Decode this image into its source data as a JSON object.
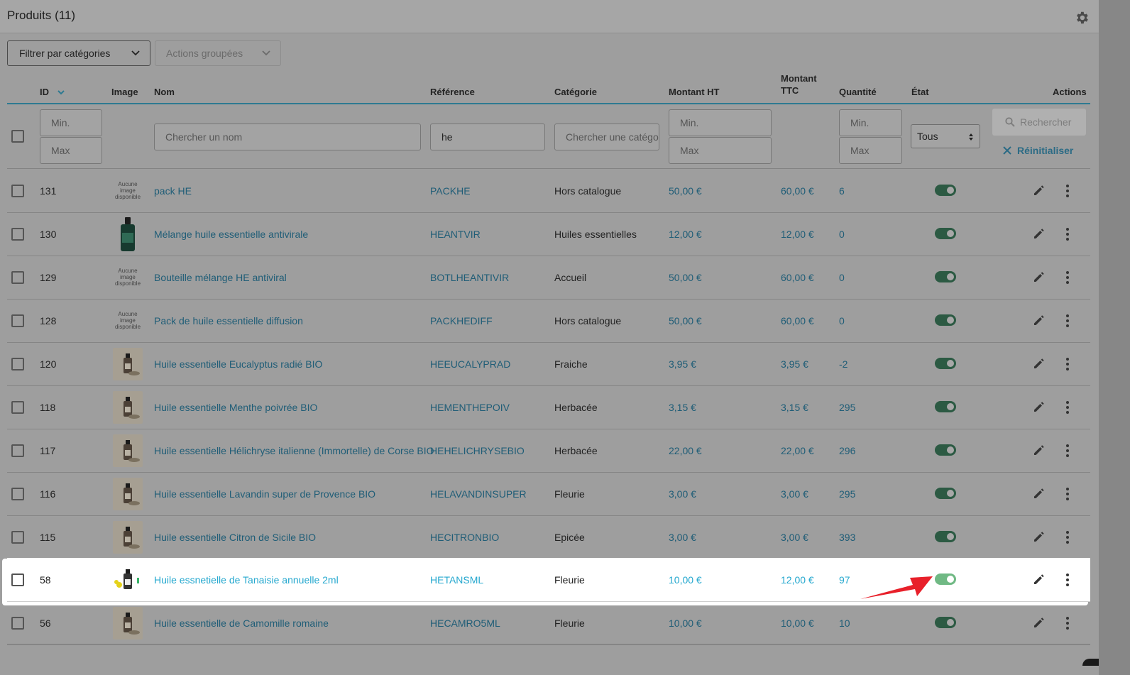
{
  "header": {
    "title": "Produits (11)"
  },
  "toolbar": {
    "filter_label": "Filtrer par catégories",
    "bulk_label": "Actions groupées"
  },
  "columns": {
    "id": "ID",
    "image": "Image",
    "name": "Nom",
    "reference": "Référence",
    "category": "Catégorie",
    "price_ht": "Montant HT",
    "price_ttc_1": "Montant",
    "price_ttc_2": "TTC",
    "quantity": "Quantité",
    "state": "État",
    "actions": "Actions"
  },
  "filters": {
    "id_min": "Min.",
    "id_max": "Max",
    "name_placeholder": "Chercher un nom",
    "reference_value": "he",
    "category_placeholder": "Chercher une catégorie",
    "price_min": "Min.",
    "price_max": "Max",
    "qty_min": "Min.",
    "qty_max": "Max",
    "state_value": "Tous",
    "search_label": "Rechercher",
    "reset_label": "Réinitialiser"
  },
  "no_image_text": [
    "Aucune",
    "image",
    "disponible"
  ],
  "rows": [
    {
      "id": "131",
      "image": "none",
      "name": "pack HE",
      "ref": "PACKHE",
      "cat": "Hors catalogue",
      "ht": "50,00 €",
      "ttc": "60,00 €",
      "qty": "6",
      "active": true
    },
    {
      "id": "130",
      "image": "bottle",
      "name": "Mélange huile essentielle antivirale",
      "ref": "HEANTVIR",
      "cat": "Huiles essentielles",
      "ht": "12,00 €",
      "ttc": "12,00 €",
      "qty": "0",
      "active": true
    },
    {
      "id": "129",
      "image": "none",
      "name": "Bouteille mélange HE antiviral",
      "ref": "BOTLHEANTIVIR",
      "cat": "Accueil",
      "ht": "50,00 €",
      "ttc": "60,00 €",
      "qty": "0",
      "active": true
    },
    {
      "id": "128",
      "image": "none",
      "name": "Pack de huile essentielle diffusion",
      "ref": "PACKHEDIFF",
      "cat": "Hors catalogue",
      "ht": "50,00 €",
      "ttc": "60,00 €",
      "qty": "0",
      "active": true
    },
    {
      "id": "120",
      "image": "photo",
      "name": "Huile essentielle Eucalyptus radié BIO",
      "ref": "HEEUCALYPRAD",
      "cat": "Fraiche",
      "ht": "3,95 €",
      "ttc": "3,95 €",
      "qty": "-2",
      "active": true
    },
    {
      "id": "118",
      "image": "photo",
      "name": "Huile essentielle Menthe poivrée BIO",
      "ref": "HEMENTHEPOIV",
      "cat": "Herbacée",
      "ht": "3,15 €",
      "ttc": "3,15 €",
      "qty": "295",
      "active": true
    },
    {
      "id": "117",
      "image": "photo",
      "name": "Huile essentielle Hélichryse italienne (Immortelle) de Corse BIO",
      "ref": "HEHELICHRYSEBIO",
      "cat": "Herbacée",
      "ht": "22,00 €",
      "ttc": "22,00 €",
      "qty": "296",
      "active": true
    },
    {
      "id": "116",
      "image": "photo",
      "name": "Huile essentielle Lavandin super de Provence BIO",
      "ref": "HELAVANDINSUPER",
      "cat": "Fleurie",
      "ht": "3,00 €",
      "ttc": "3,00 €",
      "qty": "295",
      "active": true
    },
    {
      "id": "115",
      "image": "photo",
      "name": "Huile essentielle Citron de Sicile BIO",
      "ref": "HECITRONBIO",
      "cat": "Epicée",
      "ht": "3,00 €",
      "ttc": "3,00 €",
      "qty": "393",
      "active": true
    },
    {
      "id": "58",
      "image": "photo",
      "name": "Huile essnetielle de Tanaisie annuelle 2ml",
      "ref": "HETANSML",
      "cat": "Fleurie",
      "ht": "10,00 €",
      "ttc": "12,00 €",
      "qty": "97",
      "active": true,
      "highlighted": true
    },
    {
      "id": "56",
      "image": "photo",
      "name": "Huile essentielle de Camomille romaine",
      "ref": "HECAMRO5ML",
      "cat": "Fleurie",
      "ht": "10,00 €",
      "ttc": "10,00 €",
      "qty": "10",
      "active": true
    }
  ],
  "colors": {
    "link": "#1f5d77",
    "link_highlight": "#25a8cf",
    "toggle_on": "#70b984",
    "accent_line": "#2e7a91",
    "arrow": "#e8202a"
  }
}
